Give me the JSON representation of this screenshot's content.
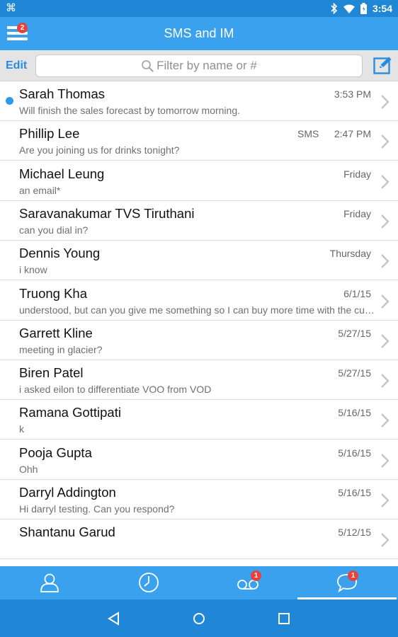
{
  "status_bar": {
    "time": "3:54",
    "icons": [
      "app-notification-icon",
      "bluetooth-icon",
      "wifi-icon",
      "battery-icon"
    ]
  },
  "header": {
    "title": "SMS and IM",
    "menu_badge": "2"
  },
  "search": {
    "edit_label": "Edit",
    "placeholder": "Filter by name or #"
  },
  "conversations": [
    {
      "name": "Sarah Thomas",
      "preview": "Will finish the sales forecast by tomorrow morning.",
      "time": "3:53 PM",
      "type": "",
      "unread": true
    },
    {
      "name": "Phillip Lee",
      "preview": "Are you joining us for drinks tonight?",
      "time": "2:47 PM",
      "type": "SMS",
      "unread": false
    },
    {
      "name": "Michael Leung",
      "preview": "an email*",
      "time": "Friday",
      "type": "",
      "unread": false
    },
    {
      "name": "Saravanakumar TVS Tiruthani",
      "preview": "can you dial in?",
      "time": "Friday",
      "type": "",
      "unread": false
    },
    {
      "name": "Dennis Young",
      "preview": "i know",
      "time": "Thursday",
      "type": "",
      "unread": false
    },
    {
      "name": "Truong Kha",
      "preview": "understood, but can you give me something so I can buy more time with the cu…",
      "time": "6/1/15",
      "type": "",
      "unread": false
    },
    {
      "name": "Garrett Kline",
      "preview": "meeting in glacier?",
      "time": "5/27/15",
      "type": "",
      "unread": false
    },
    {
      "name": "Biren Patel",
      "preview": "i asked eilon to differentiate VOO from VOD",
      "time": "5/27/15",
      "type": "",
      "unread": false
    },
    {
      "name": "Ramana Gottipati",
      "preview": "k",
      "time": "5/16/15",
      "type": "",
      "unread": false
    },
    {
      "name": "Pooja Gupta",
      "preview": "Ohh",
      "time": "5/16/15",
      "type": "",
      "unread": false
    },
    {
      "name": "Darryl Addington",
      "preview": "Hi darryl testing. Can you respond?",
      "time": "5/16/15",
      "type": "",
      "unread": false
    },
    {
      "name": "Shantanu Garud",
      "preview": "",
      "time": "5/12/15",
      "type": "",
      "unread": false
    }
  ],
  "tabs": [
    {
      "icon": "contacts-icon",
      "badge": "",
      "active": false
    },
    {
      "icon": "recents-clock-icon",
      "badge": "",
      "active": false
    },
    {
      "icon": "voicemail-icon",
      "badge": "1",
      "active": false
    },
    {
      "icon": "messages-chat-icon",
      "badge": "1",
      "active": true
    }
  ],
  "nav": [
    "back-icon",
    "home-icon",
    "recent-apps-icon"
  ],
  "colors": {
    "status_bar": "#1f87d6",
    "header": "#3aa1ef",
    "accent": "#2a8be0",
    "badge": "#e9413a",
    "unread_dot": "#2b9af0"
  }
}
